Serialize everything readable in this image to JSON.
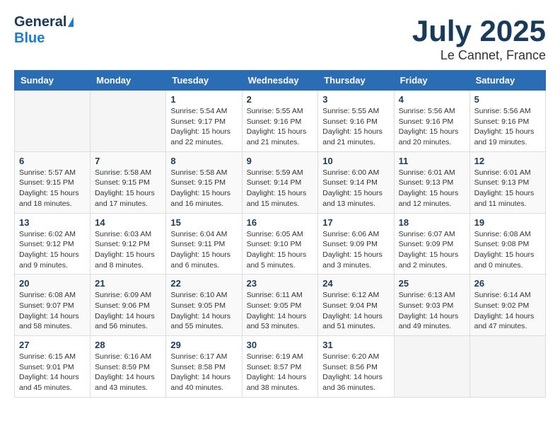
{
  "header": {
    "logo_general": "General",
    "logo_blue": "Blue",
    "month_title": "July 2025",
    "location": "Le Cannet, France"
  },
  "weekdays": [
    "Sunday",
    "Monday",
    "Tuesday",
    "Wednesday",
    "Thursday",
    "Friday",
    "Saturday"
  ],
  "weeks": [
    [
      {
        "day": "",
        "info": ""
      },
      {
        "day": "",
        "info": ""
      },
      {
        "day": "1",
        "info": "Sunrise: 5:54 AM\nSunset: 9:17 PM\nDaylight: 15 hours\nand 22 minutes."
      },
      {
        "day": "2",
        "info": "Sunrise: 5:55 AM\nSunset: 9:16 PM\nDaylight: 15 hours\nand 21 minutes."
      },
      {
        "day": "3",
        "info": "Sunrise: 5:55 AM\nSunset: 9:16 PM\nDaylight: 15 hours\nand 21 minutes."
      },
      {
        "day": "4",
        "info": "Sunrise: 5:56 AM\nSunset: 9:16 PM\nDaylight: 15 hours\nand 20 minutes."
      },
      {
        "day": "5",
        "info": "Sunrise: 5:56 AM\nSunset: 9:16 PM\nDaylight: 15 hours\nand 19 minutes."
      }
    ],
    [
      {
        "day": "6",
        "info": "Sunrise: 5:57 AM\nSunset: 9:15 PM\nDaylight: 15 hours\nand 18 minutes."
      },
      {
        "day": "7",
        "info": "Sunrise: 5:58 AM\nSunset: 9:15 PM\nDaylight: 15 hours\nand 17 minutes."
      },
      {
        "day": "8",
        "info": "Sunrise: 5:58 AM\nSunset: 9:15 PM\nDaylight: 15 hours\nand 16 minutes."
      },
      {
        "day": "9",
        "info": "Sunrise: 5:59 AM\nSunset: 9:14 PM\nDaylight: 15 hours\nand 15 minutes."
      },
      {
        "day": "10",
        "info": "Sunrise: 6:00 AM\nSunset: 9:14 PM\nDaylight: 15 hours\nand 13 minutes."
      },
      {
        "day": "11",
        "info": "Sunrise: 6:01 AM\nSunset: 9:13 PM\nDaylight: 15 hours\nand 12 minutes."
      },
      {
        "day": "12",
        "info": "Sunrise: 6:01 AM\nSunset: 9:13 PM\nDaylight: 15 hours\nand 11 minutes."
      }
    ],
    [
      {
        "day": "13",
        "info": "Sunrise: 6:02 AM\nSunset: 9:12 PM\nDaylight: 15 hours\nand 9 minutes."
      },
      {
        "day": "14",
        "info": "Sunrise: 6:03 AM\nSunset: 9:12 PM\nDaylight: 15 hours\nand 8 minutes."
      },
      {
        "day": "15",
        "info": "Sunrise: 6:04 AM\nSunset: 9:11 PM\nDaylight: 15 hours\nand 6 minutes."
      },
      {
        "day": "16",
        "info": "Sunrise: 6:05 AM\nSunset: 9:10 PM\nDaylight: 15 hours\nand 5 minutes."
      },
      {
        "day": "17",
        "info": "Sunrise: 6:06 AM\nSunset: 9:09 PM\nDaylight: 15 hours\nand 3 minutes."
      },
      {
        "day": "18",
        "info": "Sunrise: 6:07 AM\nSunset: 9:09 PM\nDaylight: 15 hours\nand 2 minutes."
      },
      {
        "day": "19",
        "info": "Sunrise: 6:08 AM\nSunset: 9:08 PM\nDaylight: 15 hours\nand 0 minutes."
      }
    ],
    [
      {
        "day": "20",
        "info": "Sunrise: 6:08 AM\nSunset: 9:07 PM\nDaylight: 14 hours\nand 58 minutes."
      },
      {
        "day": "21",
        "info": "Sunrise: 6:09 AM\nSunset: 9:06 PM\nDaylight: 14 hours\nand 56 minutes."
      },
      {
        "day": "22",
        "info": "Sunrise: 6:10 AM\nSunset: 9:05 PM\nDaylight: 14 hours\nand 55 minutes."
      },
      {
        "day": "23",
        "info": "Sunrise: 6:11 AM\nSunset: 9:05 PM\nDaylight: 14 hours\nand 53 minutes."
      },
      {
        "day": "24",
        "info": "Sunrise: 6:12 AM\nSunset: 9:04 PM\nDaylight: 14 hours\nand 51 minutes."
      },
      {
        "day": "25",
        "info": "Sunrise: 6:13 AM\nSunset: 9:03 PM\nDaylight: 14 hours\nand 49 minutes."
      },
      {
        "day": "26",
        "info": "Sunrise: 6:14 AM\nSunset: 9:02 PM\nDaylight: 14 hours\nand 47 minutes."
      }
    ],
    [
      {
        "day": "27",
        "info": "Sunrise: 6:15 AM\nSunset: 9:01 PM\nDaylight: 14 hours\nand 45 minutes."
      },
      {
        "day": "28",
        "info": "Sunrise: 6:16 AM\nSunset: 8:59 PM\nDaylight: 14 hours\nand 43 minutes."
      },
      {
        "day": "29",
        "info": "Sunrise: 6:17 AM\nSunset: 8:58 PM\nDaylight: 14 hours\nand 40 minutes."
      },
      {
        "day": "30",
        "info": "Sunrise: 6:19 AM\nSunset: 8:57 PM\nDaylight: 14 hours\nand 38 minutes."
      },
      {
        "day": "31",
        "info": "Sunrise: 6:20 AM\nSunset: 8:56 PM\nDaylight: 14 hours\nand 36 minutes."
      },
      {
        "day": "",
        "info": ""
      },
      {
        "day": "",
        "info": ""
      }
    ]
  ]
}
